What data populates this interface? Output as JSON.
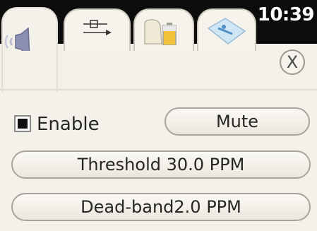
{
  "status": {
    "time": "10:39"
  },
  "tabs": [
    {
      "icon": "speaker-icon",
      "active": true
    },
    {
      "icon": "sliders-icon",
      "active": false
    },
    {
      "icon": "mouse-battery-icon",
      "active": false
    },
    {
      "icon": "device-icon",
      "active": false
    }
  ],
  "dialog": {
    "close_label": "X"
  },
  "enable": {
    "label": "Enable",
    "checked": true
  },
  "buttons": {
    "mute": "Mute",
    "threshold": "Threshold 30.0 PPM",
    "deadband": "Dead-band2.0 PPM"
  },
  "colors": {
    "tabbar": "#0c0c0c",
    "background": "#f4f1ea",
    "speaker": "#8c8fb4"
  }
}
